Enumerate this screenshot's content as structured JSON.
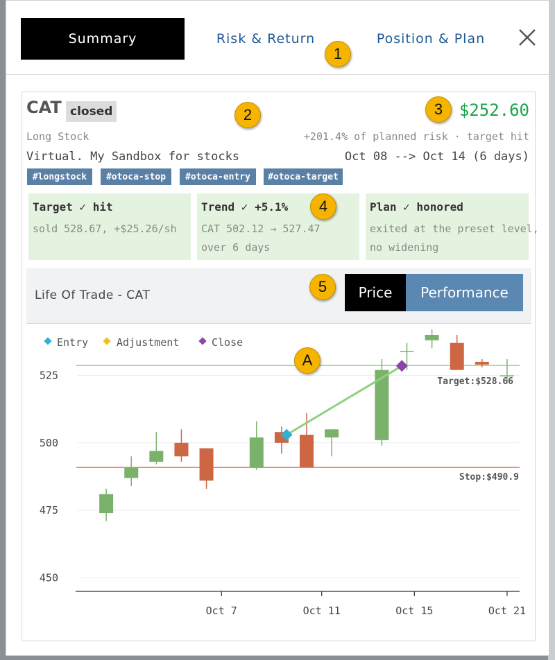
{
  "tabs": {
    "summary": "Summary",
    "risk_return": "Risk & Return",
    "position_plan": "Position & Plan"
  },
  "callouts": {
    "one": "1",
    "two": "2",
    "three": "3",
    "four": "4",
    "five": "5",
    "a": "A"
  },
  "trade": {
    "symbol": "CAT",
    "status": "closed",
    "pnl": "$252.60",
    "type": "Long Stock",
    "risk_note": "+201.4% of planned risk · target hit",
    "portfolio": "Virtual. My Sandbox for stocks",
    "dates": "Oct 08 --> Oct 14 (6 days)",
    "tags": [
      "#longstock",
      "#otoca-stop",
      "#otoca-entry",
      "#otoca-target"
    ]
  },
  "summary_boxes": [
    {
      "title": "Target ✓ hit",
      "line1": "sold 528.67, +$25.26/sh",
      "line2": ""
    },
    {
      "title": "Trend ✓ +5.1%",
      "line1": "CAT 502.12 → 527.47",
      "line2": "over 6 days"
    },
    {
      "title": "Plan ✓ honored",
      "line1": "exited at the preset level,",
      "line2": "no widening"
    }
  ],
  "life_of_trade": {
    "title": "Life Of Trade - CAT",
    "price_button": "Price",
    "performance_button": "Performance"
  },
  "colors": {
    "pnl": "#19a34a",
    "up": "#7bb26b",
    "down": "#cc6643",
    "entry": "#2fb0d4",
    "adjustment": "#f0c020",
    "close": "#8e44ad",
    "target_line": "#8fd07f",
    "stop_line": "#e07a55"
  },
  "chart_data": {
    "type": "candlestick",
    "legend": [
      "Entry",
      "Adjustment",
      "Close"
    ],
    "legend_placement": "top-left",
    "y_ticks": [
      450,
      475,
      500,
      525
    ],
    "ylim": [
      445,
      540
    ],
    "x_ticks": [
      "Oct 7",
      "Oct 11",
      "Oct 15",
      "Oct 21"
    ],
    "target_label": "Target:$528.66",
    "target_value": 528.66,
    "stop_label": "Stop:$490.9",
    "stop_value": 490.9,
    "entry": {
      "x": 8.2,
      "y": 503
    },
    "close": {
      "x": 12.8,
      "y": 528.5
    },
    "candles": [
      {
        "x": 1,
        "open": 474,
        "high": 483,
        "low": 471,
        "close": 481
      },
      {
        "x": 2,
        "open": 487,
        "high": 495,
        "low": 484,
        "close": 491
      },
      {
        "x": 3,
        "open": 493,
        "high": 504,
        "low": 492,
        "close": 497
      },
      {
        "x": 4,
        "open": 500,
        "high": 505,
        "low": 493,
        "close": 495
      },
      {
        "x": 5,
        "open": 498,
        "high": 498,
        "low": 483,
        "close": 486
      },
      {
        "x": 7,
        "open": 491,
        "high": 508,
        "low": 490,
        "close": 502
      },
      {
        "x": 8,
        "open": 504,
        "high": 506,
        "low": 496,
        "close": 500
      },
      {
        "x": 9,
        "open": 503,
        "high": 511,
        "low": 491,
        "close": 491
      },
      {
        "x": 10,
        "open": 502,
        "high": 505,
        "low": 495,
        "close": 505
      },
      {
        "x": 12,
        "open": 501,
        "high": 531,
        "low": 499,
        "close": 527
      },
      {
        "x": 13,
        "open": 534,
        "high": 537,
        "low": 527,
        "close": 534
      },
      {
        "x": 14,
        "open": 538,
        "high": 542,
        "low": 535,
        "close": 540
      },
      {
        "x": 15,
        "open": 537,
        "high": 540,
        "low": 527,
        "close": 527
      },
      {
        "x": 16,
        "open": 530,
        "high": 531,
        "low": 528,
        "close": 529
      },
      {
        "x": 17,
        "open": 525,
        "high": 531,
        "low": 522,
        "close": 525
      }
    ],
    "x_tick_positions": [
      5.6,
      9.6,
      13.3,
      17
    ]
  }
}
